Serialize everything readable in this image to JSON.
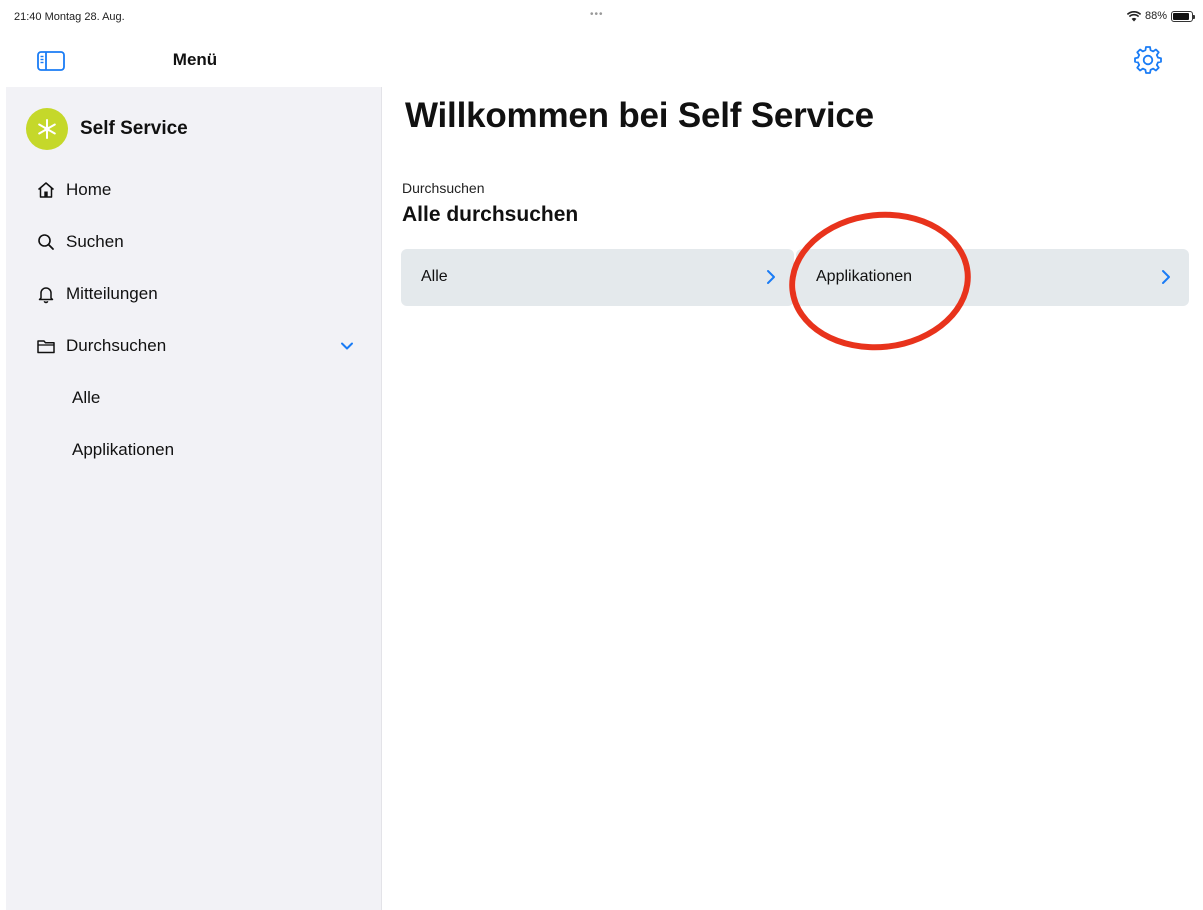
{
  "status_bar": {
    "time_date": "21:40  Montag 28. Aug.",
    "dots": "•••",
    "battery_percent": "88%",
    "battery_level": 0.88
  },
  "sidebar": {
    "title": "Menü",
    "brand": {
      "name": "Self Service",
      "logo_color": "#c5d82a"
    },
    "items": [
      {
        "label": "Home",
        "icon": "home-icon"
      },
      {
        "label": "Suchen",
        "icon": "search-icon"
      },
      {
        "label": "Mitteilungen",
        "icon": "bell-icon"
      },
      {
        "label": "Durchsuchen",
        "icon": "folder-icon",
        "expanded": true
      }
    ],
    "subitems": [
      {
        "label": "Alle"
      },
      {
        "label": "Applikationen"
      }
    ]
  },
  "main": {
    "title": "Willkommen bei Self Service",
    "section_caption": "Durchsuchen",
    "section_title": "Alle durchsuchen",
    "cards": [
      {
        "label": "Alle"
      },
      {
        "label": "Applikationen"
      }
    ]
  },
  "colors": {
    "accent": "#1a7cf5",
    "annotation": "#e8331c",
    "card_bg": "#e4e9ec",
    "sidebar_bg": "#f2f2f6"
  }
}
